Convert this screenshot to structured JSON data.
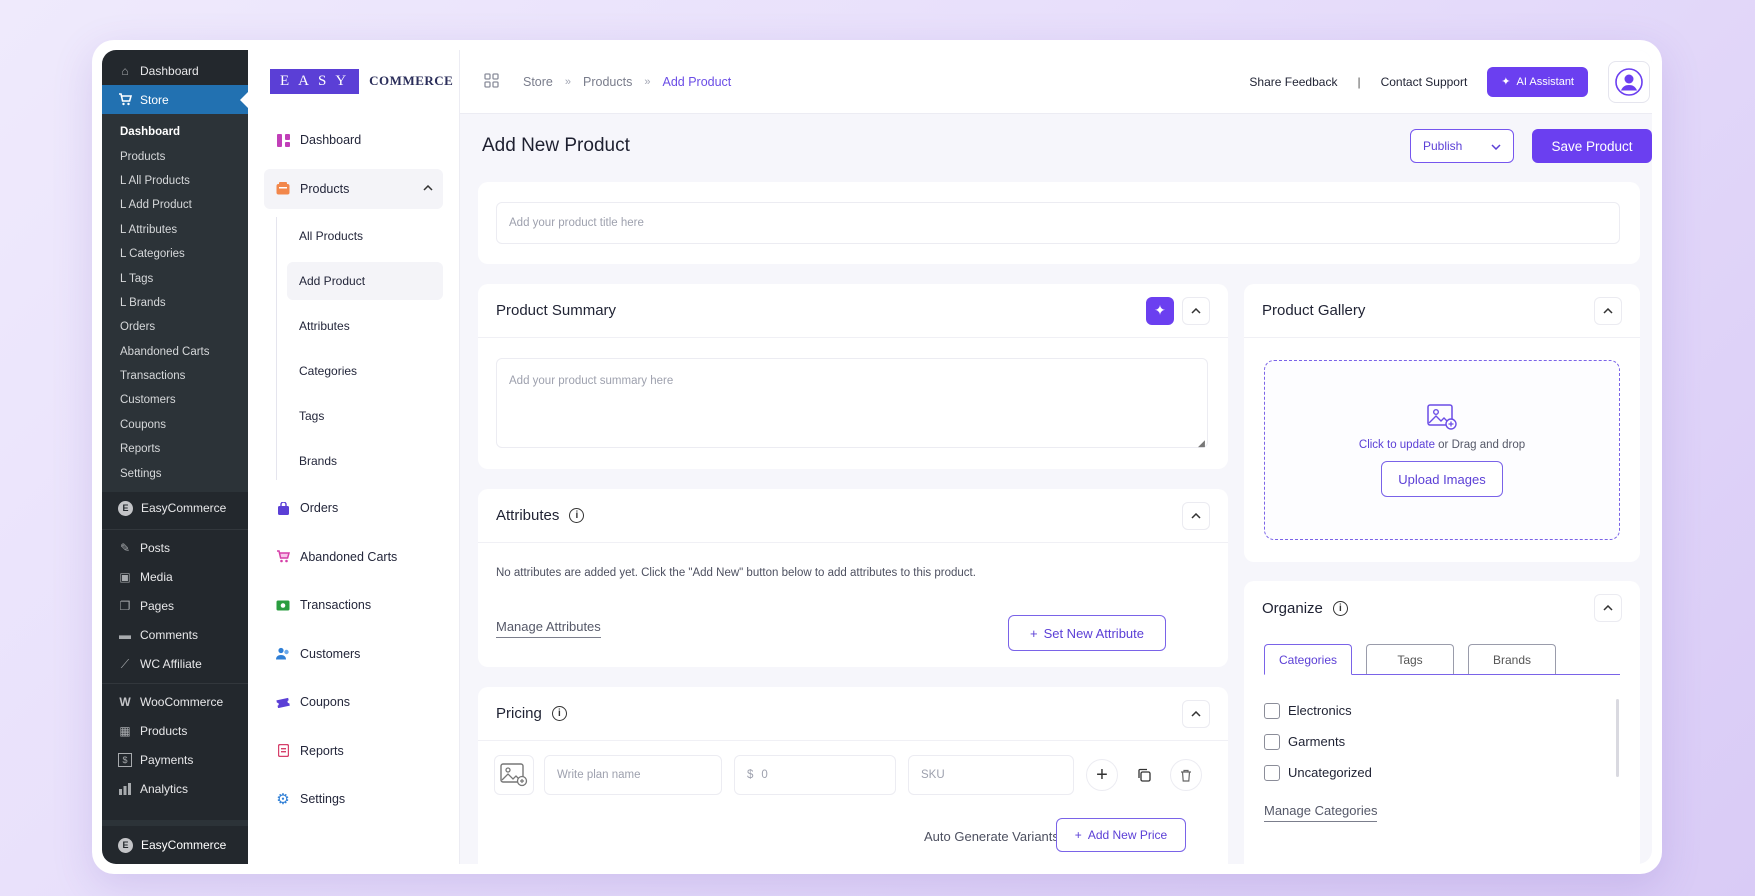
{
  "wp_sidebar": {
    "top_items": [
      {
        "label": "Dashboard",
        "icon": "home-icon"
      },
      {
        "label": "Store",
        "icon": "cart-icon"
      }
    ],
    "store_sub": [
      "Dashboard",
      "Products",
      "L All Products",
      "L Add Product",
      "L Attributes",
      "L Categories",
      "L Tags",
      "L Brands",
      "Orders",
      "Abandoned Carts",
      "Transactions",
      "Customers",
      "Coupons",
      "Reports",
      "Settings"
    ],
    "easycommerce": "EasyCommerce",
    "items": [
      {
        "label": "Posts",
        "icon": "pin-icon"
      },
      {
        "label": "Media",
        "icon": "media-icon"
      },
      {
        "label": "Pages",
        "icon": "pages-icon"
      },
      {
        "label": "Comments",
        "icon": "comment-icon"
      },
      {
        "label": "WC Affiliate",
        "icon": "chart-line-icon"
      }
    ],
    "items2": [
      {
        "label": "WooCommerce",
        "icon": "woo-icon"
      },
      {
        "label": "Products",
        "icon": "box-icon"
      },
      {
        "label": "Payments",
        "icon": "dollar-icon"
      },
      {
        "label": "Analytics",
        "icon": "bar-chart-icon"
      }
    ],
    "bottom": "EasyCommerce"
  },
  "brand": {
    "box": "EASY",
    "word": "COMMERCE"
  },
  "ec_nav": {
    "dashboard": "Dashboard",
    "products": "Products",
    "products_sub": [
      "All Products",
      "Add Product",
      "Attributes",
      "Categories",
      "Tags",
      "Brands"
    ],
    "rest": [
      {
        "label": "Orders",
        "icon": "bag-icon",
        "color": "#5b3fd6"
      },
      {
        "label": "Abandoned Carts",
        "icon": "cart-icon",
        "color": "#d63fa8"
      },
      {
        "label": "Transactions",
        "icon": "money-icon",
        "color": "#2a9d3f"
      },
      {
        "label": "Customers",
        "icon": "users-icon",
        "color": "#2f7fd6"
      },
      {
        "label": "Coupons",
        "icon": "ticket-icon",
        "color": "#5b3fd6"
      },
      {
        "label": "Reports",
        "icon": "report-icon",
        "color": "#d63f6a"
      },
      {
        "label": "Settings",
        "icon": "gear-icon",
        "color": "#2f7fd6"
      }
    ]
  },
  "breadcrumb": [
    "Store",
    "Products",
    "Add Product"
  ],
  "topbar": {
    "feedback": "Share Feedback",
    "divider": "|",
    "support": "Contact Support",
    "ai": "AI Assistant"
  },
  "page": {
    "title": "Add New Product",
    "publish": "Publish",
    "save": "Save Product"
  },
  "title_input": {
    "placeholder": "Add your product title here"
  },
  "summary": {
    "title": "Product Summary",
    "placeholder": "Add your product summary here"
  },
  "attributes": {
    "title": "Attributes",
    "empty": "No attributes are added yet. Click the \"Add New\" button below to add attributes to this product.",
    "manage": "Manage Attributes",
    "add": "Set New Attribute"
  },
  "pricing": {
    "title": "Pricing",
    "plan_placeholder": "Write plan name",
    "currency": "$",
    "price_placeholder": "0",
    "sku_placeholder": "SKU",
    "auto": "Auto Generate Variants",
    "add": "Add New Price"
  },
  "gallery": {
    "title": "Product Gallery",
    "click": "Click to update",
    "drag": " or Drag and drop",
    "upload": "Upload Images"
  },
  "organize": {
    "title": "Organize",
    "tabs": [
      "Categories",
      "Tags",
      "Brands"
    ],
    "categories": [
      "Electronics",
      "Garments",
      "Uncategorized"
    ],
    "manage": "Manage Categories"
  },
  "colors": {
    "accent": "#6b3ff0",
    "wp_active": "#2271b1",
    "wp_bg": "#23282d"
  }
}
